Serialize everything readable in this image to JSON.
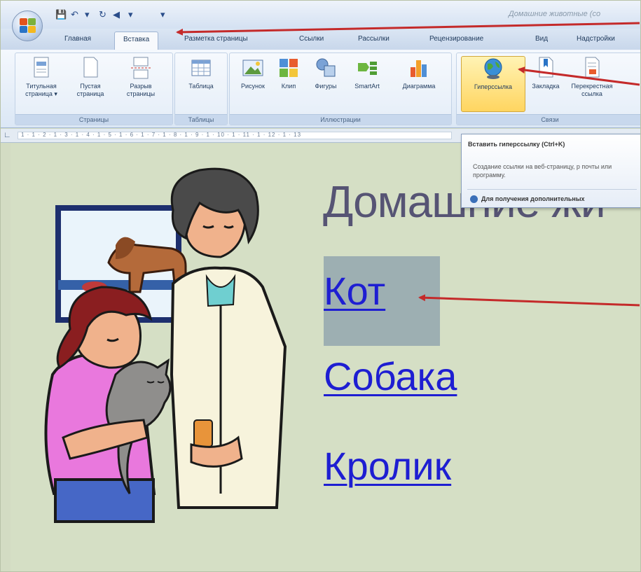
{
  "title_bar": {
    "document_title": "Домашние животные (со"
  },
  "tabs": [
    "Главная",
    "Вставка",
    "Разметка страницы",
    "Ссылки",
    "Рассылки",
    "Рецензирование",
    "Вид",
    "Надстройки"
  ],
  "ribbon": {
    "pages": {
      "label": "Страницы",
      "buttons": [
        "Титульная страница ▾",
        "Пустая страница",
        "Разрыв страницы"
      ]
    },
    "tables": {
      "label": "Таблицы",
      "buttons": [
        "Таблица"
      ]
    },
    "illustrations": {
      "label": "Иллюстрации",
      "buttons": [
        "Рисунок",
        "Клип",
        "Фигуры",
        "SmartArt",
        "Диаграмма"
      ]
    },
    "links": {
      "label": "Связи",
      "buttons": [
        "Гиперссылка",
        "Закладка",
        "Перекрестная ссылка"
      ]
    }
  },
  "ruler": {
    "marks": "1 · 1 · 2 · 1 · 3 · 1 · 4 · 1 · 5 · 1 · 6 · 1 · 7 · 1 · 8 · 1 · 9 · 1 · 10 · 1 · 11 · 1 · 12 · 1 · 13"
  },
  "tooltip": {
    "title": "Вставить гиперссылку (Ctrl+K)",
    "description": "Создание ссылки на веб-страницу, р почты или программу.",
    "help": "Для получения дополнительных"
  },
  "document": {
    "heading": "Домашние жи",
    "links": [
      "Кот",
      "Собака",
      "Кролик"
    ]
  },
  "colors": {
    "link": "#1e1ed2",
    "arrow": "#c42a2a",
    "selection": "#9dafb2"
  }
}
